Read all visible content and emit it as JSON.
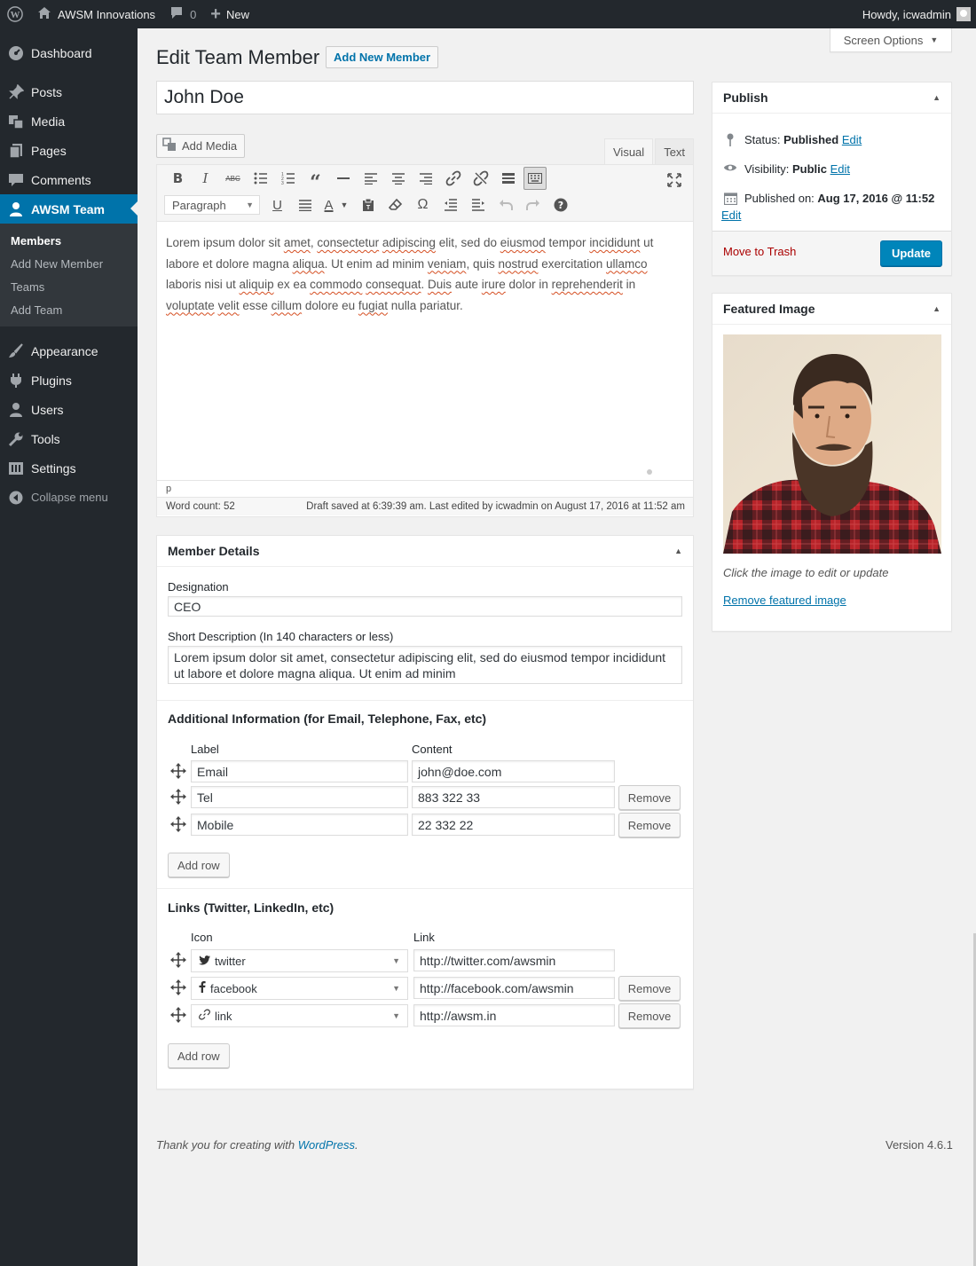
{
  "adminbar": {
    "site_name": "AWSM Innovations",
    "comments_count": "0",
    "new_label": "New",
    "howdy": "Howdy, icwadmin"
  },
  "sidebar": {
    "items": [
      {
        "label": "Dashboard",
        "icon": "dashboard-icon"
      },
      {
        "label": "Posts",
        "icon": "pin-icon"
      },
      {
        "label": "Media",
        "icon": "media-icon"
      },
      {
        "label": "Pages",
        "icon": "pages-icon"
      },
      {
        "label": "Comments",
        "icon": "comment-icon"
      },
      {
        "label": "AWSM Team",
        "icon": "user-icon"
      },
      {
        "label": "Appearance",
        "icon": "brush-icon"
      },
      {
        "label": "Plugins",
        "icon": "plugin-icon"
      },
      {
        "label": "Users",
        "icon": "users-icon"
      },
      {
        "label": "Tools",
        "icon": "wrench-icon"
      },
      {
        "label": "Settings",
        "icon": "settings-icon"
      }
    ],
    "submenu": [
      "Members",
      "Add New Member",
      "Teams",
      "Add Team"
    ],
    "collapse": "Collapse menu"
  },
  "header": {
    "screen_options": "Screen Options",
    "title": "Edit Team Member",
    "add_new": "Add New Member"
  },
  "post": {
    "title": "John Doe"
  },
  "editor": {
    "add_media": "Add Media",
    "tab_visual": "Visual",
    "tab_text": "Text",
    "format": "Paragraph",
    "content_words": [
      {
        "t": "Lorem ipsum dolor sit ",
        "s": false
      },
      {
        "t": "amet",
        "s": true
      },
      {
        "t": ", ",
        "s": false
      },
      {
        "t": "consectetur",
        "s": true
      },
      {
        "t": " ",
        "s": false
      },
      {
        "t": "adipiscing",
        "s": true
      },
      {
        "t": " elit, sed do ",
        "s": false
      },
      {
        "t": "eiusmod",
        "s": true
      },
      {
        "t": " tempor ",
        "s": false
      },
      {
        "t": "incididunt",
        "s": true
      },
      {
        "t": " ut labore et dolore magna ",
        "s": false
      },
      {
        "t": "aliqua",
        "s": true
      },
      {
        "t": ". Ut enim ad minim ",
        "s": false
      },
      {
        "t": "veniam",
        "s": true
      },
      {
        "t": ", quis ",
        "s": false
      },
      {
        "t": "nostrud",
        "s": true
      },
      {
        "t": " exercitation ",
        "s": false
      },
      {
        "t": "ullamco",
        "s": true
      },
      {
        "t": " laboris nisi ut ",
        "s": false
      },
      {
        "t": "aliquip",
        "s": true
      },
      {
        "t": " ex ea ",
        "s": false
      },
      {
        "t": "commodo",
        "s": true
      },
      {
        "t": " ",
        "s": false
      },
      {
        "t": "consequat",
        "s": true
      },
      {
        "t": ". ",
        "s": false
      },
      {
        "t": "Duis",
        "s": true
      },
      {
        "t": " aute ",
        "s": false
      },
      {
        "t": "irure",
        "s": true
      },
      {
        "t": " dolor in ",
        "s": false
      },
      {
        "t": "reprehenderit",
        "s": true
      },
      {
        "t": " in ",
        "s": false
      },
      {
        "t": "voluptate",
        "s": true
      },
      {
        "t": " ",
        "s": false
      },
      {
        "t": "velit",
        "s": true
      },
      {
        "t": " esse ",
        "s": false
      },
      {
        "t": "cillum",
        "s": true
      },
      {
        "t": " dolore eu ",
        "s": false
      },
      {
        "t": "fugiat",
        "s": true
      },
      {
        "t": " nulla pariatur.",
        "s": false
      }
    ],
    "path": "p",
    "word_count": "Word count: 52",
    "draft_status": "Draft saved at 6:39:39 am. Last edited by icwadmin on August 17, 2016 at 11:52 am"
  },
  "member_details": {
    "title": "Member Details",
    "designation_label": "Designation",
    "designation_value": "CEO",
    "short_desc_label": "Short Description (In 140 characters or less)",
    "short_desc_value": "Lorem ipsum dolor sit amet, consectetur adipiscing elit, sed do eiusmod tempor incididunt ut labore et dolore magna aliqua. Ut enim ad minim",
    "additional_title": "Additional Information (for Email, Telephone, Fax, etc)",
    "col_label": "Label",
    "col_content": "Content",
    "info_rows": [
      {
        "label": "Email",
        "content": "john@doe.com",
        "removable": false
      },
      {
        "label": "Tel",
        "content": "883 322 33",
        "removable": true
      },
      {
        "label": "Mobile",
        "content": "22 332 22",
        "removable": true
      }
    ],
    "remove_label": "Remove",
    "add_row_label": "Add row",
    "links_title": "Links (Twitter, LinkedIn, etc)",
    "col_icon": "Icon",
    "col_link": "Link",
    "link_rows": [
      {
        "icon": "twitter",
        "icon_name": "twitter-icon",
        "glyph": "🐦",
        "link": "http://twitter.com/awsmin",
        "removable": false
      },
      {
        "icon": "facebook",
        "icon_name": "facebook-icon",
        "glyph": "f",
        "link": "http://facebook.com/awsmin",
        "removable": true
      },
      {
        "icon": "link",
        "icon_name": "link-icon",
        "glyph": "🔗",
        "link": "http://awsm.in",
        "removable": true
      }
    ]
  },
  "publish": {
    "title": "Publish",
    "status_label": "Status:",
    "status_value": "Published",
    "visibility_label": "Visibility:",
    "visibility_value": "Public",
    "published_label": "Published on:",
    "published_value": "Aug 17, 2016 @ 11:52",
    "edit": "Edit",
    "trash": "Move to Trash",
    "update": "Update"
  },
  "featured": {
    "title": "Featured Image",
    "caption": "Click the image to edit or update",
    "remove": "Remove featured image"
  },
  "footer": {
    "thanks_prefix": "Thank you for creating with ",
    "wordpress": "WordPress",
    "thanks_suffix": ".",
    "version": "Version 4.6.1"
  },
  "colors": {
    "accent": "#0073aa",
    "sidebar_bg": "#23282d",
    "trash": "#aa0000",
    "update_btn": "#0085ba"
  }
}
